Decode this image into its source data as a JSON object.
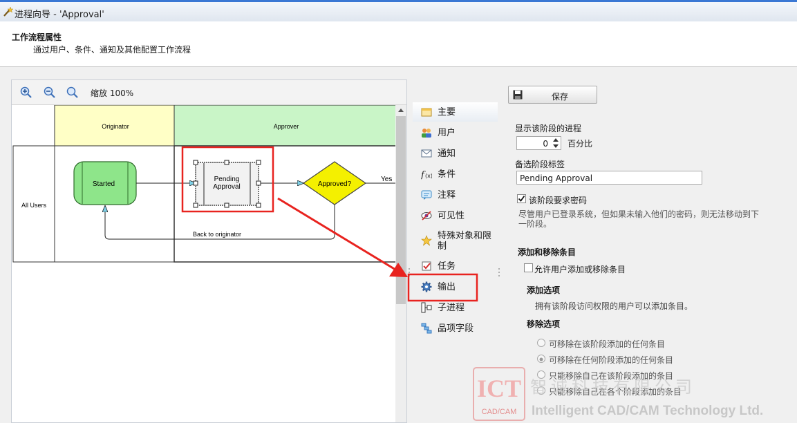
{
  "window": {
    "title": "进程向导 - 'Approval'",
    "title_icon": "wand-icon"
  },
  "header": {
    "title": "工作流程属性",
    "subtitle": "通过用户、条件、通知及其他配置工作流程"
  },
  "diagram": {
    "zoom_label": "缩放 100%",
    "zoom_buttons": [
      "zoom-in-icon",
      "zoom-out-icon",
      "zoom-fit-icon"
    ],
    "lanes": {
      "originator": "Originator",
      "approver": "Approver",
      "row": "All Users"
    },
    "nodes": {
      "started": "Started",
      "pending": "Pending Approval",
      "decision": "Approved?"
    },
    "edges": {
      "yes": "Yes",
      "back": "Back to originator"
    }
  },
  "nav": {
    "items": [
      {
        "label": "主要",
        "icon": "main-icon"
      },
      {
        "label": "用户",
        "icon": "users-icon"
      },
      {
        "label": "通知",
        "icon": "mail-icon"
      },
      {
        "label": "条件",
        "icon": "function-icon"
      },
      {
        "label": "注释",
        "icon": "comment-icon"
      },
      {
        "label": "可见性",
        "icon": "visibility-icon"
      },
      {
        "label": "特殊对象和限制",
        "icon": "star-icon"
      },
      {
        "label": "任务",
        "icon": "task-icon"
      },
      {
        "label": "输出",
        "icon": "gear-icon"
      },
      {
        "label": "子进程",
        "icon": "subprocess-icon"
      },
      {
        "label": "品项字段",
        "icon": "fields-icon"
      }
    ],
    "selected": "主要"
  },
  "form": {
    "save_label": "保存",
    "progress_label": "显示该阶段的进程",
    "progress_value": "0",
    "percent_label": "百分比",
    "stage_label_caption": "备选阶段标签",
    "stage_label_value": "Pending Approval",
    "require_password_label": "该阶段要求密码",
    "require_password_checked": true,
    "password_note": "尽管用户已登录系统，但如果未输入他们的密码，则无法移动到下一阶段。",
    "add_remove_heading": "添加和移除条目",
    "allow_add_remove_label": "允许用户添加或移除条目",
    "allow_add_remove_checked": false,
    "add_options_heading": "添加选项",
    "add_options_note": "拥有该阶段访问权限的用户可以添加条目。",
    "remove_options_heading": "移除选项",
    "remove_options": [
      "可移除在该阶段添加的任何条目",
      "可移除在任何阶段添加的任何条目",
      "只能移除自己在该阶段添加的条目",
      "只能移除自己在各个阶段添加的条目"
    ],
    "remove_selected_index": 1
  },
  "watermark": {
    "logo_text": "ICT",
    "logo_sub": "CAD/CAM",
    "company_cn": "智诚科技有限公司",
    "company_en": "Intelligent CAD/CAM Technology Ltd."
  },
  "colors": {
    "annotation_red": "#e8231f",
    "started_fill": "#8ee58a",
    "decision_fill": "#f4f000",
    "originator_lane": "#ffffc6",
    "approver_lane": "#c9f5c7"
  }
}
